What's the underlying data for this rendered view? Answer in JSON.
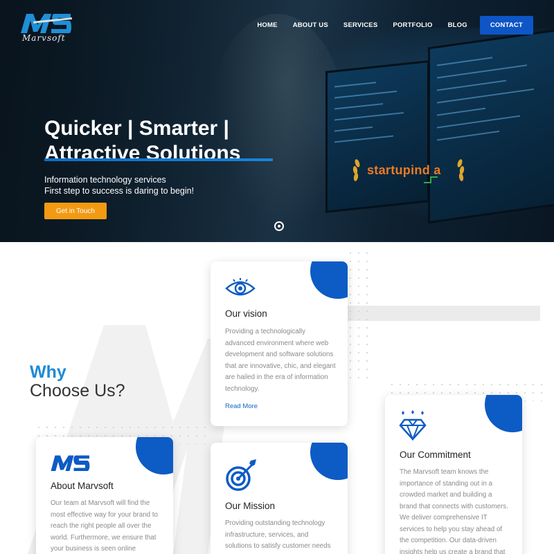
{
  "brand": {
    "logo_text": "Marvsoft"
  },
  "nav": {
    "items": [
      "HOME",
      "ABOUT US",
      "SERVICES",
      "PORTFOLIO",
      "BLOG"
    ],
    "contact": "CONTACT"
  },
  "hero": {
    "headline_line1": "Quicker | Smarter |",
    "headline_line2": "Attractive Solutions",
    "subtitle_line1": "Information technology services",
    "subtitle_line2": "First step to success is daring to begin!",
    "cta": "Get in Touch",
    "badge_text": "startupind a"
  },
  "why": {
    "line1": "Why",
    "line2": "Choose Us?"
  },
  "cards": {
    "vision": {
      "title": "Our vision",
      "text": "Providing a technologically advanced environment where web development and software solutions that are innovative, chic, and elegant are hailed in the era of information technology.",
      "link": "Read More"
    },
    "commitment": {
      "title": "Our Commitment",
      "text": "The Marvsoft team knows the importance of standing out in a crowded market and building a brand that connects with customers. We deliver comprehensive IT services to help you stay ahead of the competition. Our data-driven insights help us create a brand that"
    },
    "about": {
      "title": "About Marvsoft",
      "text": "Our team at Marvsoft will find the most effective way for your brand to reach the right people all over the world. Furthermore, we ensure that your business is seen online"
    },
    "mission": {
      "title": "Our Mission",
      "text": "Providing outstanding technology infrastructure, services, and solutions to satisfy customer needs"
    }
  },
  "colors": {
    "primary": "#0d5bc4",
    "accent": "#f39a13",
    "heading_blue": "#1e8ad6"
  },
  "icons": [
    "eye-icon",
    "diamond-icon",
    "target-icon",
    "marvsoft-logo"
  ]
}
